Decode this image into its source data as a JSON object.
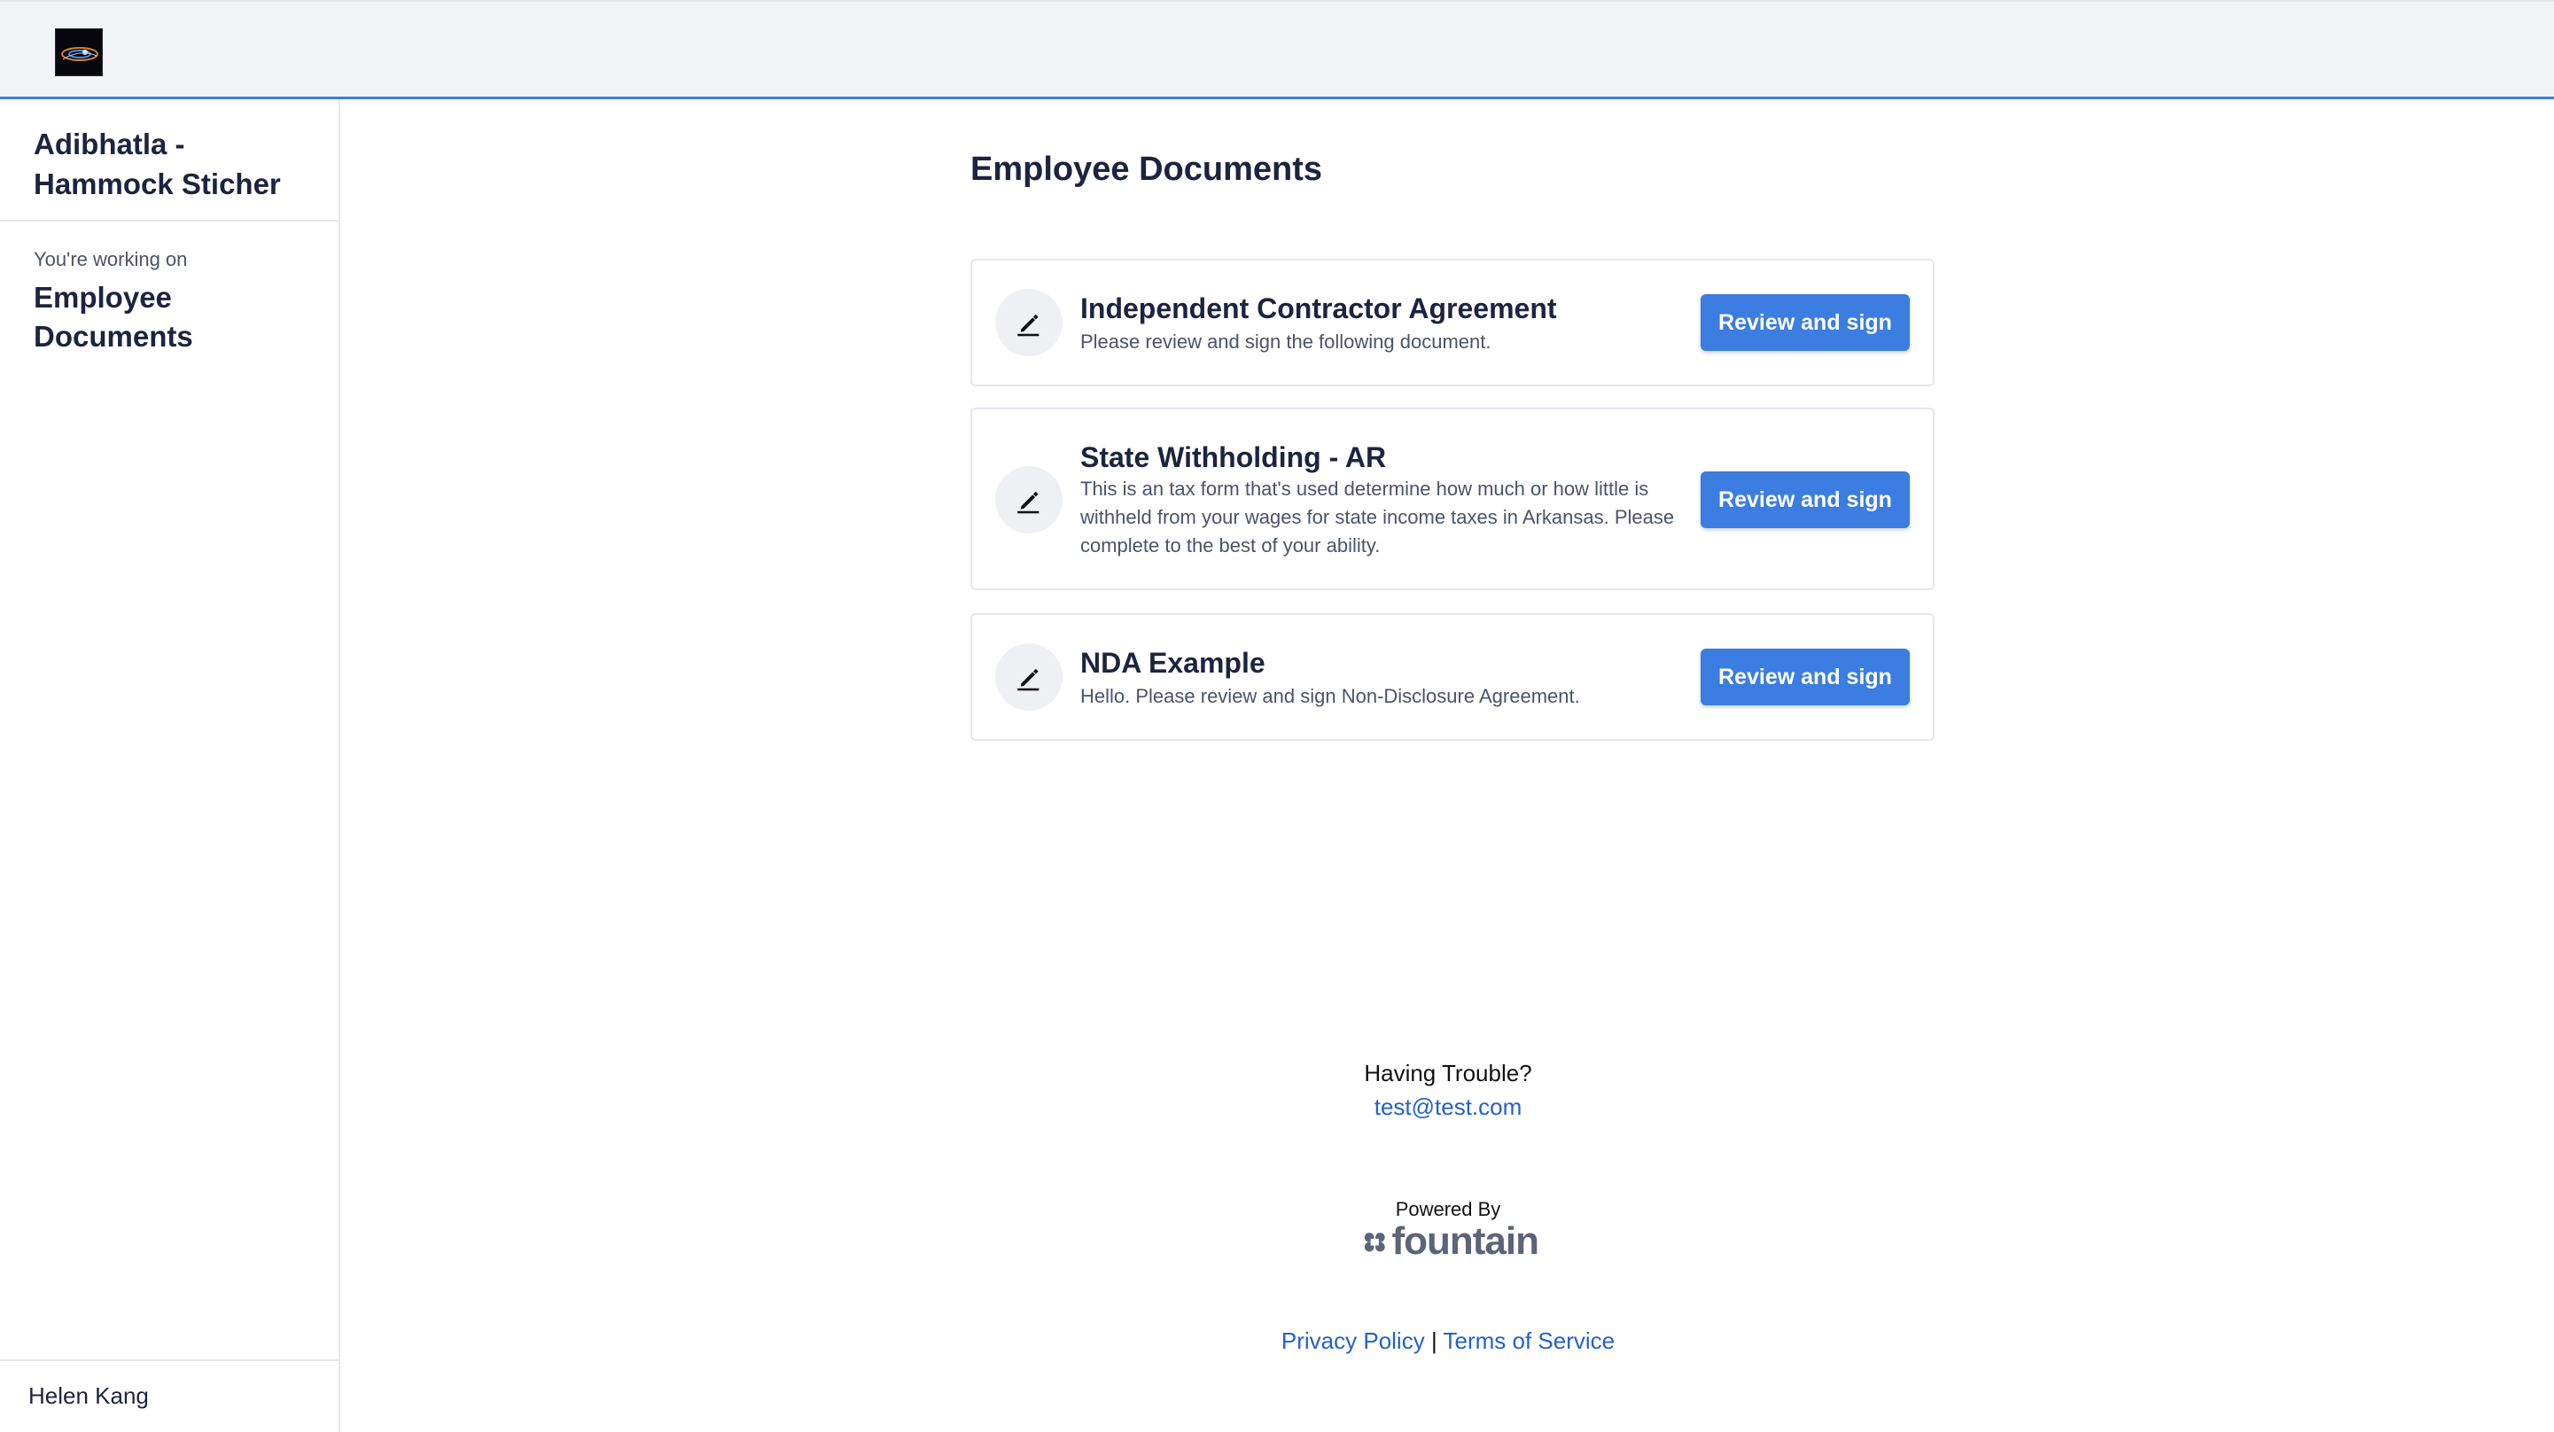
{
  "org": {
    "name": "Adibhatla - Hammock Sticher"
  },
  "workspace": {
    "label": "You're working on",
    "title": "Employee Documents"
  },
  "user": {
    "name": "Helen Kang"
  },
  "page": {
    "title": "Employee Documents"
  },
  "documents": [
    {
      "title": "Independent Contractor Agreement",
      "description": "Please review and sign the following document.",
      "action": "Review and sign",
      "icon": "signature-pen-icon"
    },
    {
      "title": "State Withholding - AR",
      "description": "This is an tax form that's used determine how much or how little is withheld from your wages for state income taxes in Arkansas. Please complete to the best of your ability.",
      "action": "Review and sign",
      "icon": "signature-pen-icon"
    },
    {
      "title": "NDA Example",
      "description": "Hello. Please review and sign Non-Disclosure Agreement.",
      "action": "Review and sign",
      "icon": "signature-pen-icon"
    }
  ],
  "footer": {
    "trouble_label": "Having Trouble?",
    "email": "test@test.com",
    "powered_by": "Powered By",
    "brand": "fountain",
    "privacy_label": "Privacy Policy",
    "separator": "|",
    "terms_label": "Terms of Service"
  },
  "colors": {
    "accent": "#3b7de0",
    "link": "#2561c8",
    "header_bg": "#f1f3f6",
    "text": "#1b2440"
  }
}
